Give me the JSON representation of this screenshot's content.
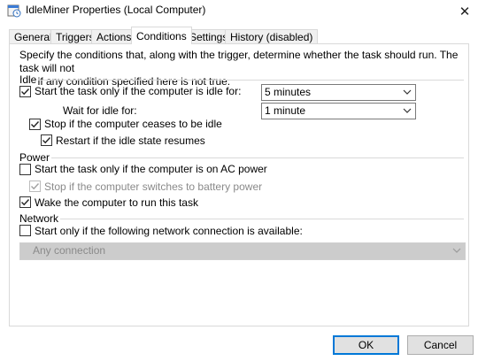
{
  "window": {
    "title": "IdleMiner Properties (Local Computer)",
    "close_glyph": "✕",
    "icon": "task-scheduler-icon"
  },
  "tabs": [
    {
      "label": "General",
      "active": false
    },
    {
      "label": "Triggers",
      "active": false
    },
    {
      "label": "Actions",
      "active": false
    },
    {
      "label": "Conditions",
      "active": true
    },
    {
      "label": "Settings",
      "active": false
    },
    {
      "label": "History (disabled)",
      "active": false
    }
  ],
  "description_line1": "Specify the conditions that, along with the trigger, determine whether the task should run.  The task will not",
  "description_line2": "run  if any condition specified here is not true.",
  "idle": {
    "group_label": "Idle",
    "start_if_idle": {
      "label": "Start the task only if the computer is idle for:",
      "checked": true
    },
    "idle_for_value": "5 minutes",
    "wait_for_idle_label": "Wait for idle for:",
    "wait_for_idle_value": "1 minute",
    "stop_if_not_idle": {
      "label": "Stop if the computer ceases to be idle",
      "checked": true
    },
    "restart_if_idle": {
      "label": "Restart if the idle state resumes",
      "checked": true
    }
  },
  "power": {
    "group_label": "Power",
    "ac_power": {
      "label": "Start the task only if the computer is on AC power",
      "checked": false
    },
    "battery_stop": {
      "label": "Stop if the computer switches to battery power",
      "checked": true,
      "disabled": true
    },
    "wake": {
      "label": "Wake the computer to run this task",
      "checked": true
    }
  },
  "network": {
    "group_label": "Network",
    "start_if_network": {
      "label": "Start only if the following network connection is available:",
      "checked": false
    },
    "connection_value": "Any connection"
  },
  "buttons": {
    "ok": "OK",
    "cancel": "Cancel"
  },
  "colors": {
    "accent": "#0078d7",
    "border": "#d9d9d9",
    "disabled_text": "#8a8a8a"
  }
}
